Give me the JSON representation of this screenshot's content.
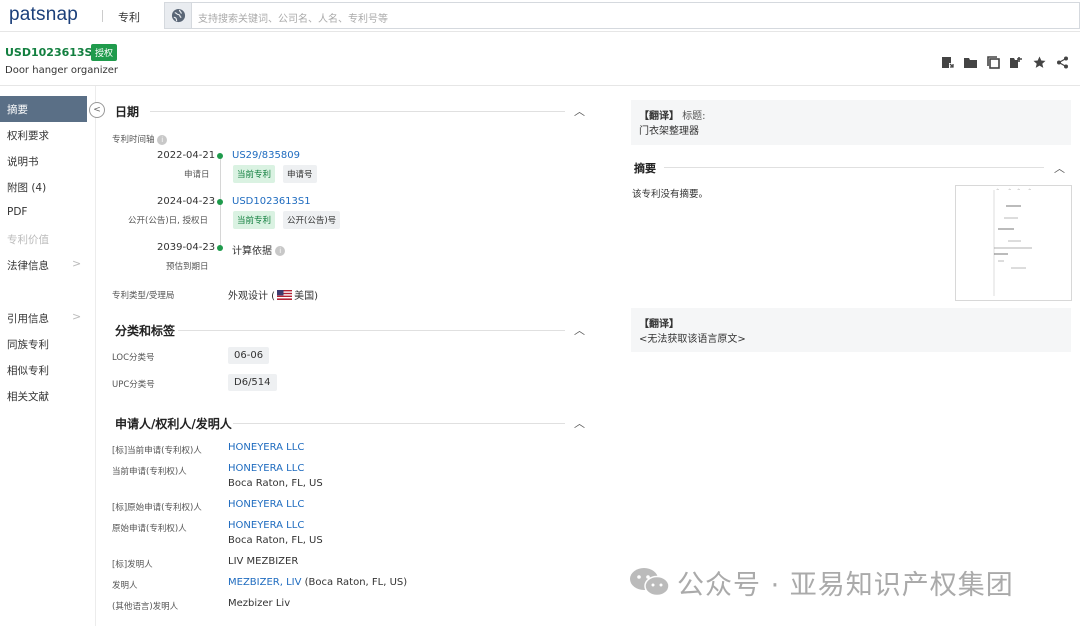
{
  "topbar": {
    "logo": "patsnap",
    "module": "专利",
    "search_placeholder": "支持搜索关键词、公司名、人名、专利号等"
  },
  "patent": {
    "number": "USD1023613S1",
    "status_badge": "授权",
    "title": "Door hanger organizer"
  },
  "sidebar": {
    "items": [
      {
        "label": "摘要"
      },
      {
        "label": "权利要求"
      },
      {
        "label": "说明书"
      },
      {
        "label": "附图 (4)"
      },
      {
        "label": "PDF"
      },
      {
        "label": "专利价值"
      },
      {
        "label": "法律信息"
      },
      {
        "label": "引用信息"
      },
      {
        "label": "同族专利"
      },
      {
        "label": "相似专利"
      },
      {
        "label": "相关文献"
      }
    ]
  },
  "dates": {
    "section_title": "日期",
    "timeline_label": "专利时间轴",
    "entries": [
      {
        "date": "2022-04-21",
        "caption": "申请日",
        "number": "US29/835809",
        "tag1": "当前专利",
        "tag2": "申请号"
      },
      {
        "date": "2024-04-23",
        "caption": "公开(公告)日, 授权日",
        "number": "USD1023613S1",
        "tag1": "当前专利",
        "tag2": "公开(公告)号"
      },
      {
        "date": "2039-04-23",
        "caption": "预估到期日",
        "basis": "计算依据"
      }
    ],
    "type_label": "专利类型/受理局",
    "type_value_prefix": "外观设计 (",
    "type_value_country": "美国)"
  },
  "classification": {
    "section_title": "分类和标签",
    "rows": [
      {
        "label": "LOC分类号",
        "value": "06-06"
      },
      {
        "label": "UPC分类号",
        "value": "D6/514"
      }
    ]
  },
  "parties": {
    "section_title": "申请人/权利人/发明人",
    "rows": [
      {
        "label": "[标]当前申请(专利权)人",
        "name": "HONEYERA LLC"
      },
      {
        "label": "当前申请(专利权)人",
        "name": "HONEYERA LLC",
        "address": "Boca Raton, FL, US"
      },
      {
        "label": "[标]原始申请(专利权)人",
        "name": "HONEYERA LLC"
      },
      {
        "label": "原始申请(专利权)人",
        "name": "HONEYERA LLC",
        "address": "Boca Raton, FL, US"
      },
      {
        "label": "[标]发明人",
        "name": "LIV MEZBIZER"
      },
      {
        "label": "发明人",
        "name": "MEZBIZER, LIV",
        "extra": "(Boca Raton, FL, US)"
      },
      {
        "label": "(其他语言)发明人",
        "name": "Mezbizer Liv"
      }
    ]
  },
  "right": {
    "translation_tag": "【翻译】",
    "title_label": "标题:",
    "title_translation": "门衣架整理器",
    "abstract_title": "摘要",
    "abstract_text": "该专利没有摘要。",
    "original_tag": "【翻译】",
    "original_text": "<无法获取该语言原文>"
  },
  "watermark": "公众号 · 亚易知识产权集团",
  "colors": {
    "brand": "#1b3f7a",
    "green": "#1f9b4c",
    "link": "#1e6bbf",
    "sidebar_active": "#5a6f86"
  }
}
